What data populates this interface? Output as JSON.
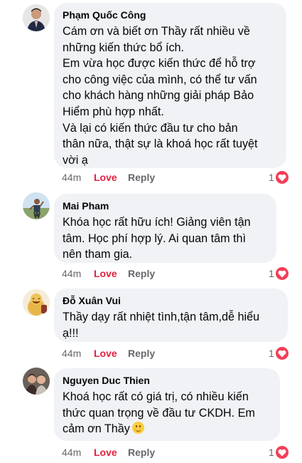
{
  "comments": [
    {
      "name": "Phạm Quốc Công",
      "text": "Cám ơn và biết ơn Thầy rất nhiều về\nnhững kiến thức bổ ích.\nEm vừa học được kiến thức để hỗ trợ\ncho công việc của mình, có thể tư vấn\ncho khách hàng những giải pháp Bảo\nHiểm phù hợp nhất.\nVà lại có kiến thức đầu tư cho bản\nthân nữa, thật sự là khoá học rất tuyệt\nvời ạ",
      "time": "44m",
      "love": "Love",
      "reply": "Reply",
      "reactions": "1"
    },
    {
      "name": "Mai Pham",
      "text": "Khóa học rất hữu ích! Giảng viên tận\ntâm. Học phí hợp lý. Ai quan tâm thì\nnên tham gia.",
      "time": "44m",
      "love": "Love",
      "reply": "Reply",
      "reactions": "1"
    },
    {
      "name": "Đỗ Xuân Vui",
      "text": "Thầy dạy rất nhiệt tình,tận tâm,dễ hiểu\nạ!!!",
      "time": "44m",
      "love": "Love",
      "reply": "Reply",
      "reactions": "1"
    },
    {
      "name": "Nguyen Duc Thien",
      "text": "Khoá học rất có giá trị, có nhiều kiến\nthức quan trọng về đầu tư CKDH. Em\ncảm ơn Thầy",
      "emoji": "smiling-face-icon",
      "time": "44m",
      "love": "Love",
      "reply": "Reply",
      "reactions": "1"
    }
  ],
  "colors": {
    "bubble": "#f0f2f5",
    "love": "#e41e3f",
    "meta": "#65676b",
    "heart": "#f33e58"
  }
}
